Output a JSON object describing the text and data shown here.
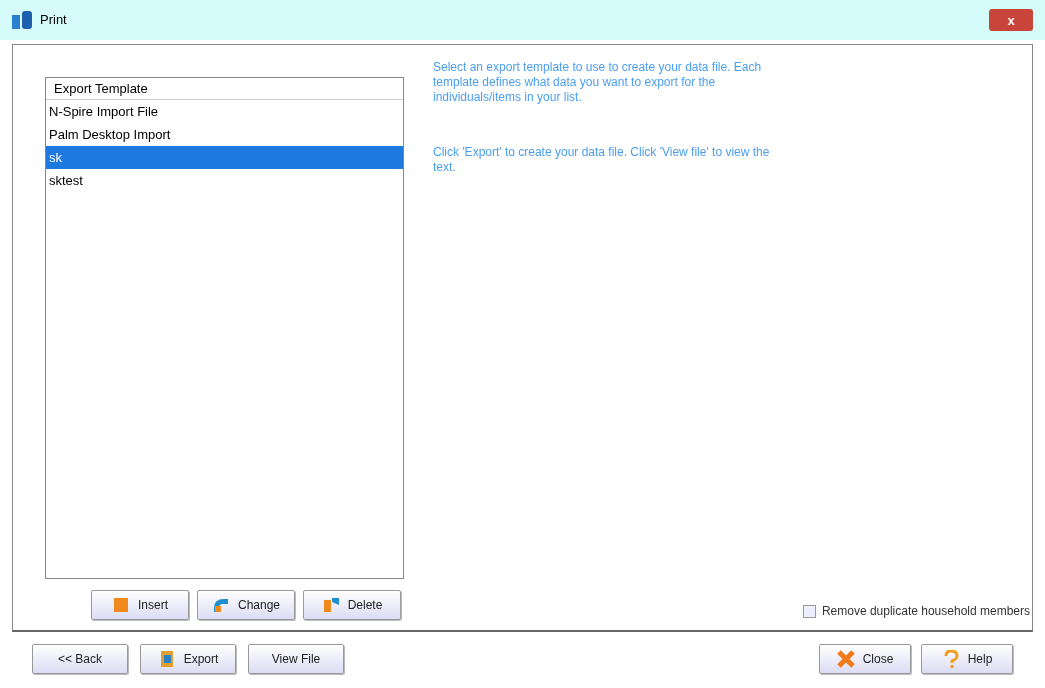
{
  "window": {
    "title": "Print",
    "close_label": "x"
  },
  "template_list": {
    "header": "Export Template",
    "items": [
      {
        "label": "N-Spire Import File",
        "selected": false
      },
      {
        "label": "Palm Desktop Import",
        "selected": false
      },
      {
        "label": "sk",
        "selected": true
      },
      {
        "label": "sktest",
        "selected": false
      }
    ]
  },
  "instructions": [
    "Select an export template to use to create your data file. Each template defines what data you want to export for the individuals/items in your list.",
    "Click 'Export' to create your data file. Click 'View file' to view the text."
  ],
  "template_buttons": [
    {
      "label": "Insert",
      "kind": "insert"
    },
    {
      "label": "Change",
      "kind": "change"
    },
    {
      "label": "Delete",
      "kind": "delete"
    }
  ],
  "remove_duplicates": {
    "label": "Remove duplicate household members",
    "checked": false
  },
  "footer_left": [
    {
      "label": "<< Back",
      "kind": "plain"
    },
    {
      "label": "Export",
      "kind": "export"
    },
    {
      "label": "View File",
      "kind": "plain"
    }
  ],
  "footer_right": [
    {
      "label": "Close",
      "kind": "close"
    },
    {
      "label": "Help",
      "kind": "help"
    }
  ]
}
